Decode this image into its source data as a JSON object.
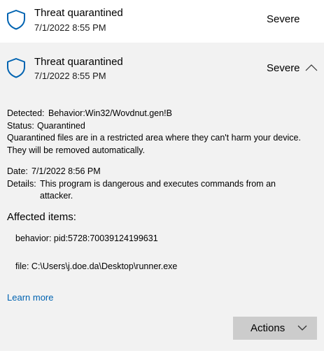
{
  "items": [
    {
      "title": "Threat quarantined",
      "time": "7/1/2022 8:55 PM",
      "severity": "Severe",
      "icon": "shield-icon"
    },
    {
      "title": "Threat quarantined",
      "time": "7/1/2022 8:55 PM",
      "severity": "Severe",
      "icon": "shield-icon",
      "expanded": true,
      "details": {
        "detected_label": "Detected:",
        "detected_value": "Behavior:Win32/Wovdnut.gen!B",
        "status_label": "Status:",
        "status_value": "Quarantined",
        "status_desc_line1": "Quarantined files are in a restricted area where they can't harm your device.",
        "status_desc_line2": "They will be removed automatically.",
        "date_label": "Date:",
        "date_value": "7/1/2022 8:56 PM",
        "details_label": "Details:",
        "details_line1": "This program is dangerous and executes commands from an",
        "details_line2": "attacker.",
        "affected_heading": "Affected items:",
        "affected_items": [
          "behavior: pid:5728:70039124199631",
          "file: C:\\Users\\j.doe.da\\Desktop\\runner.exe"
        ],
        "learn_more": "Learn more",
        "actions_label": "Actions"
      }
    }
  ],
  "colors": {
    "shield": "#0063b1",
    "link": "#0063b1",
    "expanded_bg": "#f2f2f2",
    "actions_bg": "#cccccc"
  }
}
